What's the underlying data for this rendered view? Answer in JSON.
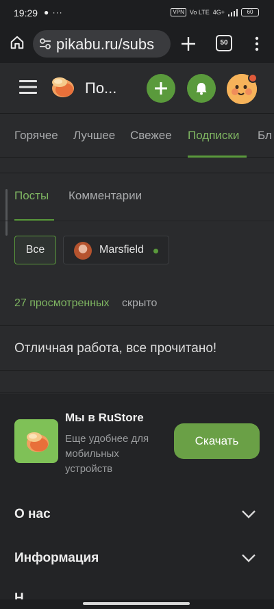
{
  "status_bar": {
    "time": "19:29",
    "left_icons": "● ···",
    "vpn": "VPN",
    "volte": "Vo LTE",
    "network": "4G+",
    "battery": "60"
  },
  "browser": {
    "url": "pikabu.ru/subs",
    "tabs_count": "50"
  },
  "header": {
    "site_title": "По...",
    "accent_color": "#5a9a3c"
  },
  "nav": {
    "items": [
      {
        "label": "Горячее"
      },
      {
        "label": "Лучшее"
      },
      {
        "label": "Свежее"
      },
      {
        "label": "Подписки"
      },
      {
        "label": "Бл"
      }
    ],
    "active_index": 3
  },
  "tabs": {
    "posts": "Посты",
    "comments": "Комментарии"
  },
  "filters": {
    "all": "Все",
    "user": "Marsfield"
  },
  "viewed": {
    "link": "27 просмотренных",
    "rest": "скрыто"
  },
  "done_message": "Отличная работа, все прочитано!",
  "rustore": {
    "title": "Мы в RuStore",
    "description": "Еще удобнее для мобильных устройств",
    "button": "Скачать"
  },
  "footer_sections": [
    {
      "label": "О нас"
    },
    {
      "label": "Информация"
    },
    {
      "label": "Н..."
    }
  ]
}
